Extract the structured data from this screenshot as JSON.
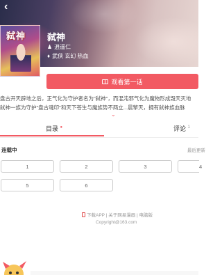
{
  "book": {
    "title": "弑神",
    "cover_title": "弑神",
    "author": "逍遥仁",
    "tags": "武侠 玄幻 热血"
  },
  "actions": {
    "read_first": "观看第一话"
  },
  "intro": {
    "line1": "盘古开天辟地之后，正气化为守护者名为\"弑神\"，而混沌邪气化为魔物形成毁天灭地",
    "line2": "弑神一族为守护\"盘古魂印\"和天下苍生与魔族势不两立...晨擎天，拥有弑神族血脉"
  },
  "tabs": {
    "catalog": "目录",
    "comments": "评论",
    "comments_count": "1"
  },
  "catalog": {
    "status": "连载中",
    "sort": "最后更新",
    "chapters": [
      "1",
      "2",
      "3",
      "4",
      "5",
      "6"
    ]
  },
  "footer": {
    "links": "下载APP | 关于网易漫画 | 电脑版",
    "copyright": "Copyright@163.com"
  },
  "colors": {
    "accent": "#f25a63",
    "text": "#333333",
    "muted": "#999999"
  },
  "icons": {
    "back": "back-arrow-icon",
    "author": "user-icon",
    "tags": "tag-icon",
    "read": "book-icon",
    "expand": "chevron-down-icon",
    "download": "phone-icon"
  }
}
